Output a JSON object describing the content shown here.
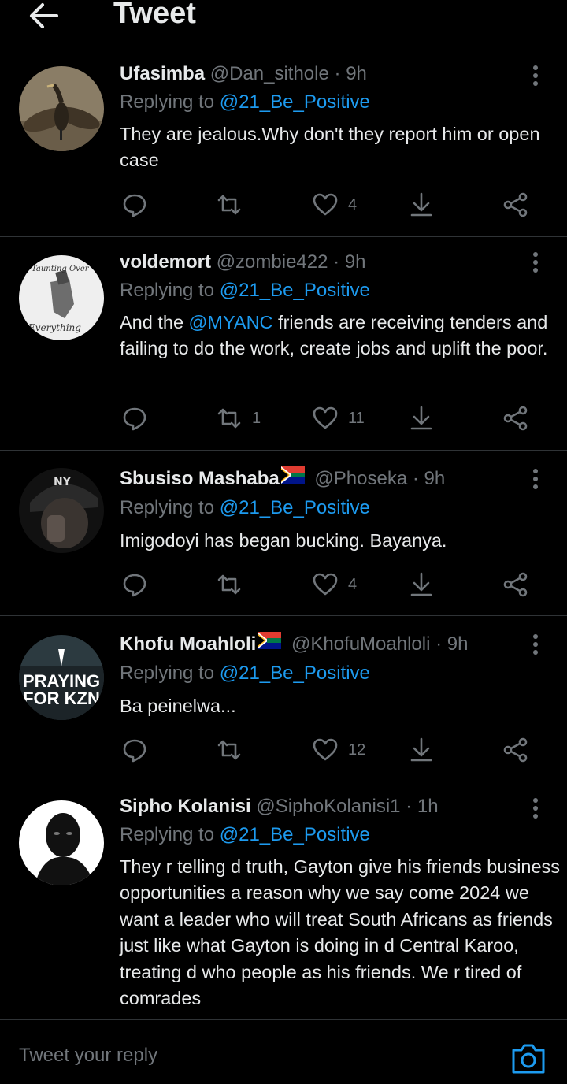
{
  "header": {
    "title": "Tweet",
    "back_icon": "arrow-left-icon"
  },
  "reply_prefix": "Replying to",
  "tweets": [
    {
      "name": "Ufasimba",
      "handle": "@Dan_sithole",
      "separator": "·",
      "time": "9h",
      "replying_to": "@21_Be_Positive",
      "text": "They are jealous.Why don't they report him or open case",
      "retweets": "",
      "likes": "4"
    },
    {
      "name": "voldemort",
      "handle": "@zombie422",
      "separator": "·",
      "time": "9h",
      "replying_to": "@21_Be_Positive",
      "text_before": "And the ",
      "text_mention": "@MYANC",
      "text_after": " friends are receiving tenders and failing to do the work, create jobs and uplift the poor.",
      "retweets": "1",
      "likes": "11",
      "avatar_text_top": "Taunting Over",
      "avatar_text_bottom": "Everything"
    },
    {
      "name": "Sbusiso Mashaba",
      "handle": "@Phoseka",
      "separator": "·",
      "time": "9h",
      "replying_to": "@21_Be_Positive",
      "text": "Imigodoyi has began bucking. Bayanya.",
      "retweets": "",
      "likes": "4"
    },
    {
      "name": "Khofu Moahloli",
      "handle": "@KhofuMoahloli",
      "separator": "·",
      "time": "9h",
      "replying_to": "@21_Be_Positive",
      "text": "Ba peinelwa...",
      "retweets": "",
      "likes": "12",
      "avatar_text_top": "PRAYING",
      "avatar_text_bottom": "FOR KZN"
    },
    {
      "name": "Sipho Kolanisi",
      "handle": "@SiphoKolanisi1",
      "separator": "·",
      "time": "1h",
      "replying_to": "@21_Be_Positive",
      "text": "They r telling d truth, Gayton give his friends business opportunities a reason why we say come 2024 we want a leader who will treat South Africans as friends just like what Gayton is doing in d Central Karoo, treating d who people as his friends. We r tired of comrades",
      "retweets": "",
      "likes": ""
    }
  ],
  "reply_bar": {
    "placeholder": "Tweet your reply",
    "camera_icon": "camera-icon"
  },
  "colors": {
    "background": "#000000",
    "text": "#e7e9ea",
    "secondary": "#71767b",
    "accent": "#1d9bf0",
    "divider": "#2f3336"
  }
}
